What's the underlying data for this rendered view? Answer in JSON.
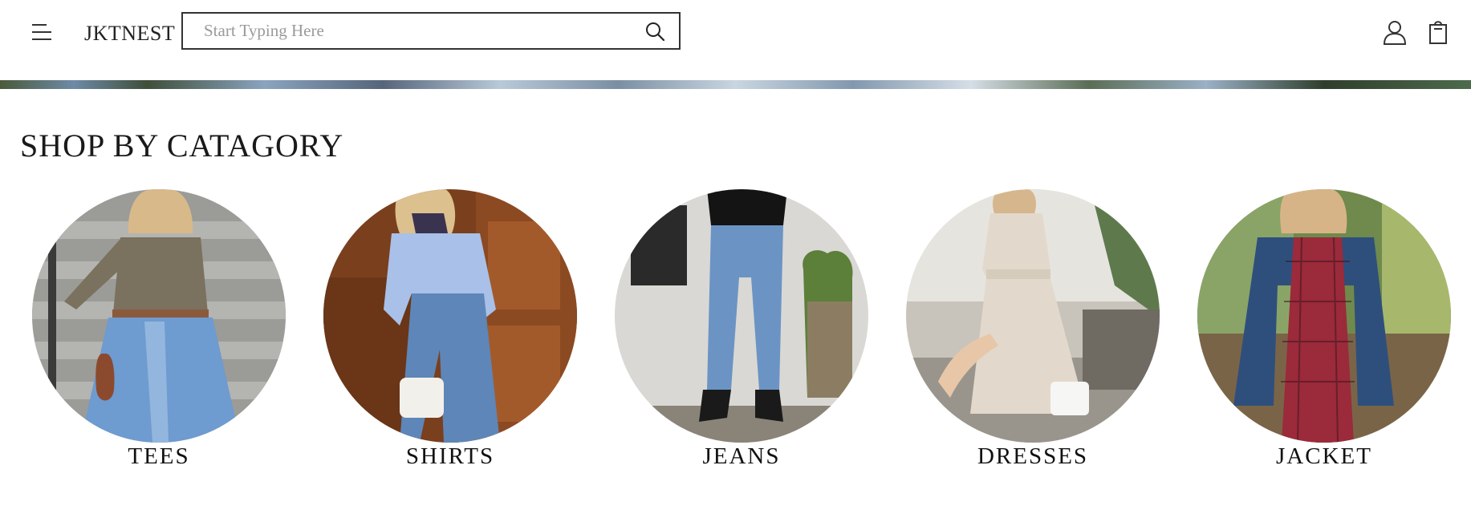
{
  "header": {
    "logo": "JKTNEST",
    "search": {
      "placeholder": "Start Typing Here",
      "value": ""
    }
  },
  "section": {
    "title": "SHOP BY CATAGORY"
  },
  "categories": [
    {
      "label": "TEES"
    },
    {
      "label": "SHIRTS"
    },
    {
      "label": "JEANS"
    },
    {
      "label": "DRESSES"
    },
    {
      "label": "JACKET"
    }
  ],
  "icons": {
    "menu": "hamburger-menu-icon",
    "search": "search-icon",
    "account": "user-icon",
    "cart": "shopping-bag-icon"
  }
}
